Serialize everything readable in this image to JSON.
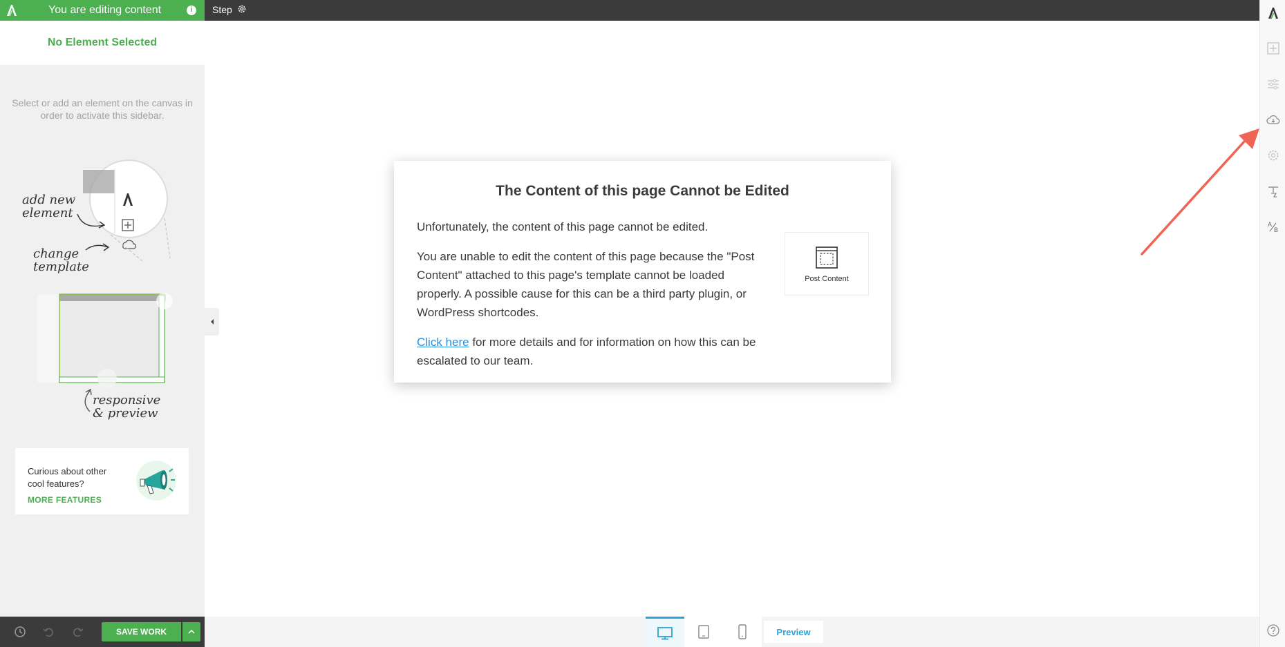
{
  "topbar": {
    "editing_banner": "You are editing content",
    "step_label": "Step",
    "info_icon": "info-icon",
    "gear_icon": "gear-icon"
  },
  "sidebar": {
    "header_title": "No Element Selected",
    "hint": "Select or add an element on the canvas in order to activate this sidebar.",
    "illustration": {
      "add_element_text": "add new element",
      "change_template_text": "change template",
      "responsive_text": "responsive & preview"
    },
    "features_card": {
      "text": "Curious about other cool features?",
      "link": "MORE FEATURES"
    },
    "footer": {
      "save_label": "SAVE WORK"
    }
  },
  "card": {
    "title": "The Content of this page Cannot be Edited",
    "para1": "Unfortunately, the content of this page cannot be edited.",
    "para2": "You are unable to edit the content of this page because the \"Post Content\" attached to this page's template cannot be loaded properly. A possible cause for this can be a third party plugin, or WordPress shortcodes.",
    "link_text": "Click here",
    "para3_rest": " for more details and for information on how this can be escalated to our team.",
    "post_content_label": "Post Content"
  },
  "bottom_bar": {
    "preview_label": "Preview",
    "active_device": "desktop"
  },
  "right_rail": {
    "icons": [
      "logo-icon",
      "add-element-icon",
      "sliders-icon",
      "cloud-download-icon",
      "settings-icon",
      "typography-icon",
      "ab-test-icon",
      "help-icon"
    ]
  },
  "colors": {
    "brand_green": "#4caf50",
    "dark_bar": "#3b3b3b",
    "accent_blue": "#2aa3d8",
    "annotation_red": "#f06455"
  }
}
